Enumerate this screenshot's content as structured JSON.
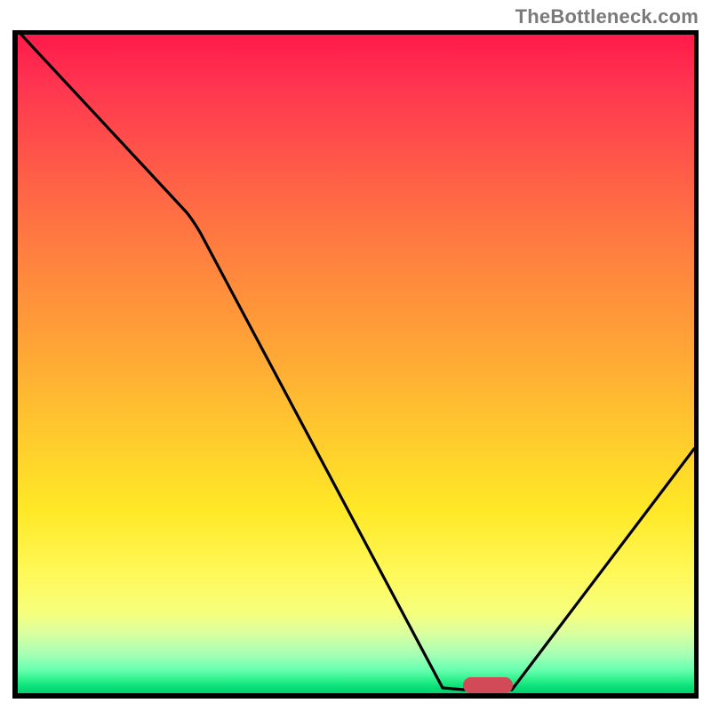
{
  "attribution": "TheBottleneck.com",
  "chart_data": {
    "type": "line",
    "title": "",
    "xlabel": "",
    "ylabel": "",
    "xlim": [
      0,
      100
    ],
    "ylim": [
      0,
      100
    ],
    "grid": false,
    "legend": false,
    "series": [
      {
        "name": "bottleneck-curve",
        "x": [
          0.5,
          25,
          63,
          66,
          73,
          100
        ],
        "y": [
          100,
          73,
          0.5,
          0.5,
          0.5,
          37
        ]
      }
    ],
    "marker": {
      "x_center": 69.5,
      "y": 0.6,
      "label": "optimum-zone"
    },
    "colors": {
      "curve": "#000000",
      "marker": "#d24a57",
      "gradient_top": "#ff1a4b",
      "gradient_bottom": "#00d26e"
    }
  }
}
